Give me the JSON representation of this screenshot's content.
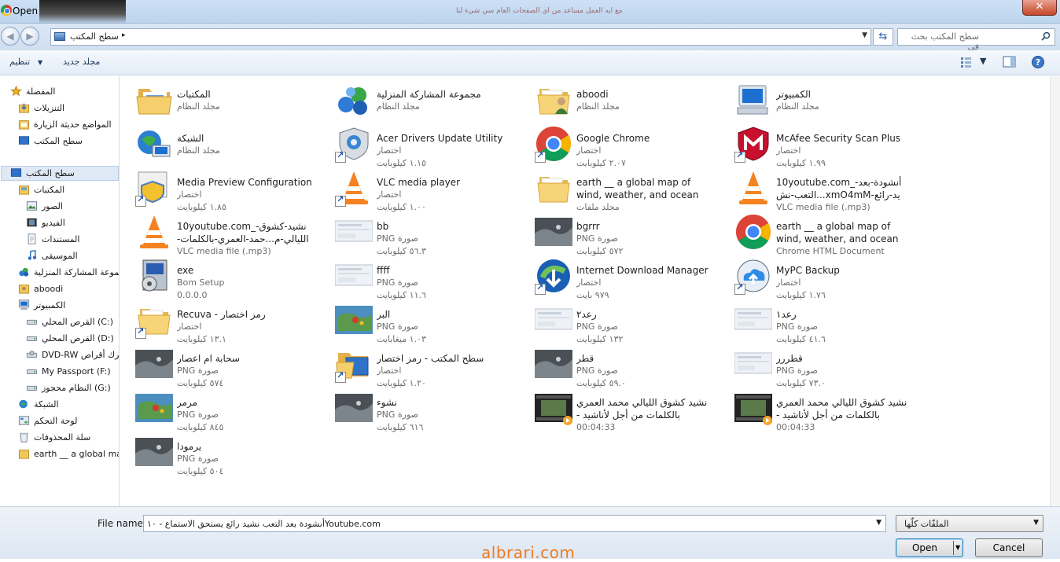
{
  "window": {
    "title": "Open",
    "close_glyph": "✕",
    "background_tabs_text": "مع ايه العمل مساعد من اي الصفحات العام سي شيء لنا"
  },
  "address": {
    "crumb": "سطح المكتب",
    "arrow": "▸",
    "search_placeholder": "سطح المكتب بحث في"
  },
  "toolbar": {
    "organize_label": "تنظيم",
    "new_folder_label": "مجلد جديد"
  },
  "sidebar": {
    "items": [
      {
        "label": "المفضلة",
        "icon": "star-icon"
      },
      {
        "label": "التنزيلات",
        "icon": "downloads-icon"
      },
      {
        "label": "المواضع حديثة الزيارة",
        "icon": "recent-places-icon"
      },
      {
        "label": "سطح المكتب",
        "icon": "desktop-icon"
      },
      {
        "label": "سطح المكتب",
        "icon": "desktop-icon"
      },
      {
        "label": "المكتبات",
        "icon": "libraries-icon"
      },
      {
        "label": "الصور",
        "icon": "pictures-icon"
      },
      {
        "label": "الفيديو",
        "icon": "videos-icon"
      },
      {
        "label": "المستندات",
        "icon": "documents-icon"
      },
      {
        "label": "الموسيقى",
        "icon": "music-icon"
      },
      {
        "label": "مجموعة المشاركة المنزلية",
        "icon": "homegroup-icon"
      },
      {
        "label": "aboodi",
        "icon": "user-icon"
      },
      {
        "label": "الكمبيوتر",
        "icon": "computer-icon"
      },
      {
        "label": "القرص المحلي (C:)",
        "icon": "drive-icon"
      },
      {
        "label": "القرص المحلي (D:)",
        "icon": "drive-icon"
      },
      {
        "label": "DVD-RW محرك أقراص",
        "icon": "dvd-icon"
      },
      {
        "label": "My Passport (F:)",
        "icon": "drive-icon"
      },
      {
        "label": "النظام محجوز (G:)",
        "icon": "drive-icon"
      },
      {
        "label": "الشبكة",
        "icon": "network-icon"
      },
      {
        "label": "لوحة التحكم",
        "icon": "control-panel-icon"
      },
      {
        "label": "سلة المحذوفات",
        "icon": "recycle-bin-icon"
      },
      {
        "label": "earth __ a global ma",
        "icon": "folder-icon"
      }
    ]
  },
  "files": [
    {
      "name": "المكتبات",
      "sub1": "مجلد النظام",
      "sub2": "",
      "icon": "libraries-icon",
      "shortcut": false
    },
    {
      "name": "مجموعة المشاركة المنزلية",
      "sub1": "مجلد النظام",
      "sub2": "",
      "icon": "homegroup-icon",
      "shortcut": false
    },
    {
      "name": "aboodi",
      "sub1": "مجلد النظام",
      "sub2": "",
      "icon": "user-folder-icon",
      "shortcut": false
    },
    {
      "name": "الكمبيوتر",
      "sub1": "مجلد النظام",
      "sub2": "",
      "icon": "computer-icon",
      "shortcut": false
    },
    {
      "name": "الشبكة",
      "sub1": "مجلد النظام",
      "sub2": "",
      "icon": "network-icon",
      "shortcut": false
    },
    {
      "name": "Acer Drivers Update Utility",
      "sub1": "اختصار",
      "sub2": "١.١٥ كيلوبايت",
      "icon": "gear-shield-icon",
      "shortcut": true
    },
    {
      "name": "Google Chrome",
      "sub1": "اختصار",
      "sub2": "٢.٠٧ كيلوبايت",
      "icon": "chrome-icon",
      "shortcut": true
    },
    {
      "name": "McAfee Security Scan Plus",
      "sub1": "اختصار",
      "sub2": "١.٩٩ كيلوبايت",
      "icon": "mcafee-icon",
      "shortcut": true
    },
    {
      "name": "Media Preview Configuration",
      "sub1": "اختصار",
      "sub2": "١.٨٥ كيلوبايت",
      "icon": "media-preview-icon",
      "shortcut": true
    },
    {
      "name": "VLC media player",
      "sub1": "اختصار",
      "sub2": "١.٠٠ كيلوبايت",
      "icon": "vlc-icon",
      "shortcut": true
    },
    {
      "name": "earth __ a global map of wind, weather, and ocean conditions_fil...",
      "sub1": "مجلد ملفات",
      "sub2": "",
      "icon": "folder-icon",
      "shortcut": false
    },
    {
      "name": "10youtube.com_أنشودة-بعد-التعب-نش...xmO4mMيد-رائع-يستحق-الاستماع_٨...",
      "sub1": "VLC media file (.mp3)",
      "sub2": "",
      "icon": "vlc-icon",
      "shortcut": false
    },
    {
      "name": "10youtube.com_نشيد-كشوق-الليالي-م...حمد-العمري-بالكلمات-من-أجل-لأناش",
      "sub1": "VLC media file (.mp3)",
      "sub2": "",
      "icon": "vlc-icon",
      "shortcut": false
    },
    {
      "name": "bb",
      "sub1": "PNG صورة",
      "sub2": "٥٦.٣ كيلوبايت",
      "icon": "image-light-icon",
      "shortcut": false
    },
    {
      "name": "bgrrr",
      "sub1": "PNG صورة",
      "sub2": "٥٧٢ كيلوبايت",
      "icon": "image-dark-icon",
      "shortcut": false
    },
    {
      "name": "earth __ a global map of wind, weather, and ocean conditions",
      "sub1": "Chrome HTML Document",
      "sub2": "",
      "icon": "chrome-icon",
      "shortcut": false
    },
    {
      "name": "exe",
      "sub1": "Bom Setup",
      "sub2": "0.0.0.0",
      "icon": "installer-icon",
      "shortcut": false
    },
    {
      "name": "ffff",
      "sub1": "PNG صورة",
      "sub2": "١١.٦ كيلوبايت",
      "icon": "image-light-icon",
      "shortcut": false
    },
    {
      "name": "Internet Download Manager",
      "sub1": "اختصار",
      "sub2": "٩٧٩ بايت",
      "icon": "idm-icon",
      "shortcut": true
    },
    {
      "name": "MyPC Backup",
      "sub1": "اختصار",
      "sub2": "١.٧٦ كيلوبايت",
      "icon": "cloud-backup-icon",
      "shortcut": true
    },
    {
      "name": "Recuva - رمز اختصار",
      "sub1": "اختصار",
      "sub2": "١٣.١ كيلوبايت",
      "icon": "folder-shortcut-icon",
      "shortcut": true
    },
    {
      "name": "البر",
      "sub1": "PNG صورة",
      "sub2": "١.٠٣ ميغابايت",
      "icon": "image-map-icon",
      "shortcut": false
    },
    {
      "name": "رعد٢",
      "sub1": "PNG صورة",
      "sub2": "١٣٢ كيلوبايت",
      "icon": "image-light-icon",
      "shortcut": false
    },
    {
      "name": "رعد١",
      "sub1": "PNG صورة",
      "sub2": "٤١.٦ كيلوبايت",
      "icon": "image-light-icon",
      "shortcut": false
    },
    {
      "name": "سحابة ام اعصار",
      "sub1": "PNG صورة",
      "sub2": "٥٧٤ كيلوبايت",
      "icon": "image-dark-icon",
      "shortcut": false
    },
    {
      "name": "سطح المكتب - رمز اختصار",
      "sub1": "اختصار",
      "sub2": "١.٢٠ كيلوبايت",
      "icon": "desktop-shortcut-icon",
      "shortcut": true
    },
    {
      "name": "قطر",
      "sub1": "PNG صورة",
      "sub2": "٥٩.٠ كيلوبايت",
      "icon": "image-dark-icon",
      "shortcut": false
    },
    {
      "name": "قطررر",
      "sub1": "PNG صورة",
      "sub2": "٧٣.٠ كيلوبايت",
      "icon": "image-light-icon",
      "shortcut": false
    },
    {
      "name": "مرمر",
      "sub1": "PNG صورة",
      "sub2": "٨٤٥ كيلوبايت",
      "icon": "image-map-icon",
      "shortcut": false
    },
    {
      "name": "نشوء",
      "sub1": "PNG صورة",
      "sub2": "٦١٦ كيلوبايت",
      "icon": "image-dark-icon",
      "shortcut": false
    },
    {
      "name": "نشيد كشوق الليالي محمد العمري بالكلمات من أجل لأناشيد - ١٠Youtube.com",
      "sub1": "00:04:33",
      "sub2": "",
      "icon": "video-thumb-icon",
      "shortcut": false
    },
    {
      "name": "نشيد كشوق الليالي محمد العمري بالكلمات من أجل لأناشيد - ١٠Youtube.com",
      "sub1": "00:04:33",
      "sub2": "",
      "icon": "video-thumb-icon",
      "shortcut": false
    },
    {
      "name": "يرمودا",
      "sub1": "PNG صورة",
      "sub2": "٥٠٤ كيلوبايت",
      "icon": "image-dark-icon",
      "shortcut": false
    }
  ],
  "bottom": {
    "file_name_label": "File name:",
    "file_name_value": "أنشودة بعد التعب نشيد رائع يستحق الاستماع - ١٠Youtube.com",
    "file_type_value": "الملفّات كلّها",
    "open_label": "Open",
    "cancel_label": "Cancel"
  },
  "watermark": "albrari.com",
  "colors": {
    "accent": "#3c7fb1",
    "watermark": "#f07c1e",
    "folder": "#f2c45a"
  }
}
